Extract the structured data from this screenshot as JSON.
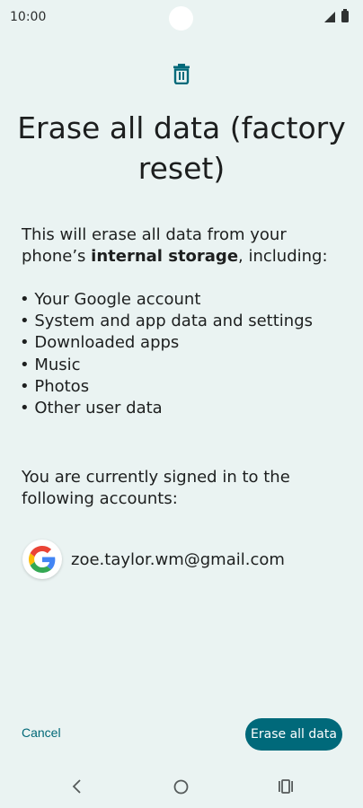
{
  "status_bar": {
    "time": "10:00",
    "icons": [
      "signal-icon",
      "battery-icon"
    ]
  },
  "header": {
    "icon": "trash-icon",
    "title": "Erase all data (factory reset)"
  },
  "intro": {
    "text_before": "This will erase all data from your phone’s ",
    "bold": "internal storage",
    "text_after": ", including:"
  },
  "data_items": [
    "Your Google account",
    "System and app data and settings",
    "Downloaded apps",
    "Music",
    "Photos",
    "Other user data"
  ],
  "accounts": {
    "heading": "You are currently signed in to the following accounts:",
    "items": [
      {
        "icon": "google-icon",
        "email": "zoe.taylor.wm@gmail.com"
      }
    ]
  },
  "actions": {
    "cancel_label": "Cancel",
    "erase_label": "Erase all data"
  },
  "nav_bar": {
    "icons": [
      "back-icon",
      "home-icon",
      "recents-icon"
    ]
  },
  "colors": {
    "background": "#eaf3f2",
    "accent": "#00697a",
    "text": "#1d1f1f"
  }
}
